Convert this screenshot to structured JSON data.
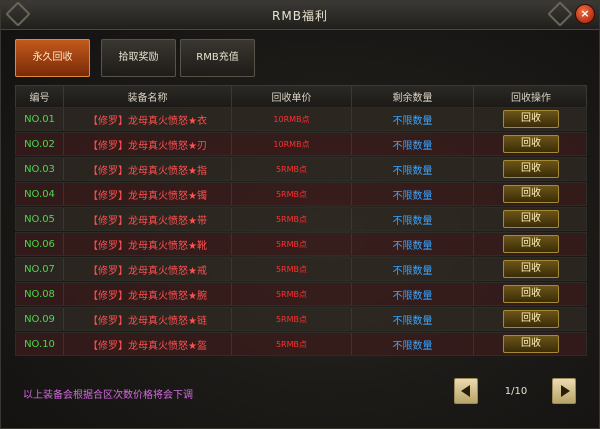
{
  "window": {
    "title": "RMB福利",
    "close_label": "×"
  },
  "tabs": [
    {
      "label": "永久回收",
      "active": true
    },
    {
      "label": "拾取奖励",
      "active": false
    },
    {
      "label": "RMB充值",
      "active": false
    }
  ],
  "table": {
    "headers": [
      "编号",
      "装备名称",
      "回收单价",
      "剩余数量",
      "回收操作"
    ],
    "rows": [
      {
        "id": "NO.01",
        "name": "【修罗】龙母真火愤怒★衣",
        "price": "10RMB点",
        "qty": "不限数量",
        "action": "回收"
      },
      {
        "id": "NO.02",
        "name": "【修罗】龙母真火愤怒★刃",
        "price": "10RMB点",
        "qty": "不限数量",
        "action": "回收"
      },
      {
        "id": "NO.03",
        "name": "【修罗】龙母真火愤怒★指",
        "price": "5RMB点",
        "qty": "不限数量",
        "action": "回收"
      },
      {
        "id": "NO.04",
        "name": "【修罗】龙母真火愤怒★镯",
        "price": "5RMB点",
        "qty": "不限数量",
        "action": "回收"
      },
      {
        "id": "NO.05",
        "name": "【修罗】龙母真火愤怒★带",
        "price": "5RMB点",
        "qty": "不限数量",
        "action": "回收"
      },
      {
        "id": "NO.06",
        "name": "【修罗】龙母真火愤怒★靴",
        "price": "5RMB点",
        "qty": "不限数量",
        "action": "回收"
      },
      {
        "id": "NO.07",
        "name": "【修罗】龙母真火愤怒★戒",
        "price": "5RMB点",
        "qty": "不限数量",
        "action": "回收"
      },
      {
        "id": "NO.08",
        "name": "【修罗】龙母真火愤怒★腕",
        "price": "5RMB点",
        "qty": "不限数量",
        "action": "回收"
      },
      {
        "id": "NO.09",
        "name": "【修罗】龙母真火愤怒★链",
        "price": "5RMB点",
        "qty": "不限数量",
        "action": "回收"
      },
      {
        "id": "NO.10",
        "name": "【修罗】龙母真火愤怒★盔",
        "price": "5RMB点",
        "qty": "不限数量",
        "action": "回收"
      }
    ]
  },
  "footer": {
    "note": "以上装备会根据合区次数价格将会下调",
    "page": "1/10"
  },
  "colors": {
    "id": "#4cd84c",
    "name": "#ff5050",
    "price": "#ff3030",
    "qty": "#3aa4ff",
    "note": "#d36ae0",
    "active_tab": "#c25a1c"
  },
  "icons": {
    "prev": "arrow-left-icon",
    "next": "arrow-right-icon",
    "close": "close-icon"
  }
}
